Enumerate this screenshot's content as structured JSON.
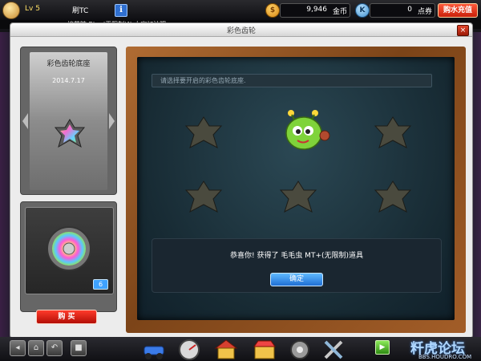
{
  "player": {
    "level": "Lv 5",
    "nickname": "刷TC"
  },
  "currency": {
    "gold_icon": "coin-icon",
    "gold_value": "9,946",
    "gold_unit": "金币",
    "k_icon": "k-coin-icon",
    "k_value": "0",
    "k_unit": "点券",
    "recharge_label": "购水充值"
  },
  "ticker": {
    "message": "sv棉花糖 Blue(无限制)]! 大家加油哦"
  },
  "window": {
    "title": "彩色齿轮",
    "close_label": "×"
  },
  "preview": {
    "title": "彩色齿轮底座",
    "date": "2014.7.17"
  },
  "inventory": {
    "count": "6",
    "buy_label": "购 买"
  },
  "board": {
    "hint": "请选择要开启的彩色齿轮底座.",
    "result_text": "恭喜你! 获得了 毛毛虫 MT+(无限制)道具",
    "ok_label": "确定"
  },
  "footer": {
    "watermark": "粁虎论坛",
    "watermark_url": "BBS.HOUDRO.COM"
  },
  "colors": {
    "accent": "#2f6fd0",
    "board_frame": "#8b4f22",
    "buy": "#c8200a",
    "confirm": "#1f6fd4"
  }
}
